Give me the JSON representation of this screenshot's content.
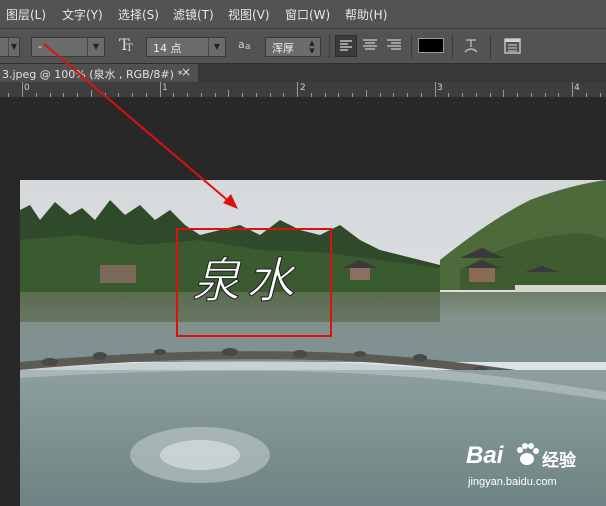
{
  "menubar": {
    "items": [
      "图层(L)",
      "文字(Y)",
      "选择(S)",
      "滤镜(T)",
      "视图(V)",
      "窗口(W)",
      "帮助(H)"
    ]
  },
  "options": {
    "font_style_value": "-",
    "font_size_icon": "font-size-icon",
    "font_size_value": "14 点",
    "antialias_label": "a",
    "antialias_value": "浑厚",
    "align_left": "align-left-icon",
    "align_center": "align-center-icon",
    "align_right": "align-right-icon",
    "text_color": "#000000",
    "warp_icon": "warp-text-icon",
    "panels_icon": "character-panel-icon"
  },
  "document": {
    "tab_title": "3.jpeg @ 100% (泉水 , RGB/8#) *",
    "close_glyph": "×"
  },
  "ruler": {
    "labels": [
      "0",
      "1",
      "2",
      "3",
      "4"
    ]
  },
  "canvas": {
    "text_layer": "泉水",
    "annotation_color": "#e01010"
  },
  "watermark": {
    "brand": "Bai",
    "brand_suffix": "经验",
    "url": "jingyan.baidu.com"
  }
}
